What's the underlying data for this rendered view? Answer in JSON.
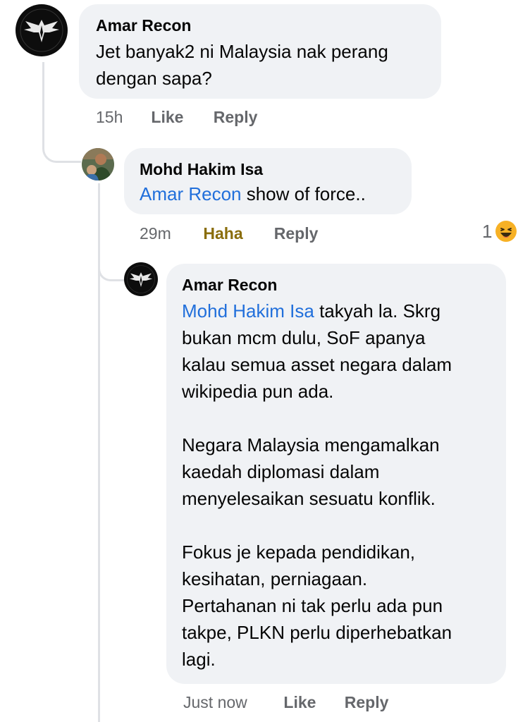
{
  "comments": [
    {
      "author": "Amar Recon",
      "lines": [
        "Jet banyak2 ni Malaysia nak perang",
        "dengan sapa?"
      ],
      "time": "15h",
      "like_label": "Like",
      "reply_label": "Reply",
      "avatar_icon": "wings-emblem-icon"
    },
    {
      "author": "Mohd Hakim Isa",
      "mention": "Amar Recon",
      "text": " show of force..",
      "time": "29m",
      "reaction_label": "Haha",
      "reply_label": "Reply",
      "reaction_count": "1",
      "reaction_icon": "haha-emoji-icon",
      "avatar_icon": "profile-photo-icon"
    },
    {
      "author": "Amar Recon",
      "mention": "Mohd Hakim Isa",
      "line1_rest": " takyah la. Skrg",
      "lines": [
        "bukan mcm dulu, SoF apanya",
        "kalau semua asset negara dalam",
        "wikipedia pun ada.",
        "",
        "Negara Malaysia mengamalkan",
        "kaedah diplomasi dalam",
        "menyelesaikan sesuatu konflik.",
        "",
        "Fokus je kepada pendidikan,",
        "kesihatan, perniagaan.",
        "Pertahanan ni tak perlu ada pun",
        "takpe, PLKN perlu diperhebatkan",
        "lagi."
      ],
      "time": "Just now",
      "like_label": "Like",
      "reply_label": "Reply",
      "avatar_icon": "wings-emblem-icon"
    }
  ],
  "colors": {
    "bubble": "#f0f2f5",
    "mention": "#216fdb",
    "meta": "#65676b",
    "haha": "#8a6d0b",
    "thread_line": "#dfe1e5"
  }
}
